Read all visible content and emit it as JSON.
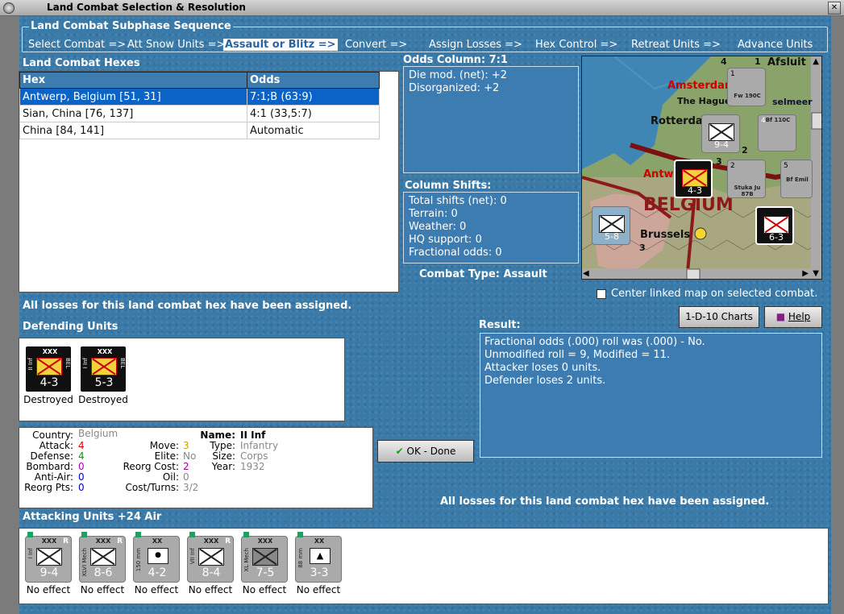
{
  "window": {
    "title": "Land Combat Selection & Resolution"
  },
  "phase": {
    "label": "Land Combat Subphase Sequence",
    "steps": [
      "Select Combat =>",
      "Att Snow Units =>",
      "Assault or Blitz =>",
      "Convert =>",
      "Assign Losses =>",
      "Hex Control =>",
      "Retreat Units =>",
      "Advance Units"
    ]
  },
  "hexes": {
    "label": "Land Combat Hexes",
    "columns": [
      "Hex",
      "Odds"
    ],
    "rows": [
      [
        "Antwerp, Belgium [51, 31]",
        "7:1;B (63:9)"
      ],
      [
        "Sian, China [76, 137]",
        "4:1 (33,5:7)"
      ],
      [
        "China [84, 141]",
        "Automatic"
      ]
    ]
  },
  "odds": {
    "label": "Odds Column: 7:1",
    "lines": [
      "Die mod. (net): +2",
      "Disorganized: +2"
    ]
  },
  "shifts": {
    "label": "Column Shifts:",
    "lines": [
      "Total shifts (net): 0",
      "Terrain: 0",
      "Weather: 0",
      "HQ support: 0",
      "Fractional odds: 0"
    ]
  },
  "combat_type": "Combat Type:  Assault",
  "map": {
    "labels": [
      "Afsluit",
      "Amsterdam",
      "The Hague",
      "selmeer",
      "Rotterdam",
      "Antwerp",
      "BELGIUM",
      "Brussels"
    ],
    "hexnums": [
      "4",
      "1",
      "2",
      "3",
      "3"
    ],
    "units": [
      {
        "name": "Fw 190C",
        "str": "1"
      },
      {
        "name": "Bf 110C",
        "str": "4"
      },
      {
        "name": "9-4",
        "str": "9-4"
      },
      {
        "name": "4-3",
        "str": "4-3"
      },
      {
        "name": "Stuka Ju 87B",
        "str": "2"
      },
      {
        "name": "Bf Emil",
        "str": "5"
      },
      {
        "name": "5-8",
        "str": "5-8"
      },
      {
        "name": "6-3",
        "str": "6-3"
      }
    ]
  },
  "center_link": "Center linked map on selected combat.",
  "losses_msg": "All losses for this land combat hex have been assigned.",
  "buttons": {
    "charts": "1-D-10 Charts",
    "help": "Help",
    "ok": "OK - Done"
  },
  "defending": {
    "label": "Defending Units",
    "units": [
      {
        "name": "II Inf",
        "nat": "BEL",
        "size": "XXX",
        "str": "4-3",
        "status": "Destroyed"
      },
      {
        "name": "I Inf",
        "nat": "BEL",
        "size": "XXX",
        "str": "5-3",
        "status": "Destroyed"
      }
    ]
  },
  "result": {
    "label": "Result:",
    "lines": [
      "Fractional odds (.000) roll was (.000)  - No.",
      "Unmodified roll = 9, Modified = 11.",
      "Attacker loses 0 units.",
      "Defender loses 2 units."
    ]
  },
  "info": {
    "country_k": "Country:",
    "country": "Belgium",
    "attack_k": "Attack:",
    "attack": "4",
    "defense_k": "Defense:",
    "defense": "4",
    "bombard_k": "Bombard:",
    "bombard": "0",
    "antiair_k": "Anti-Air:",
    "antiair": "0",
    "reorgpts_k": "Reorg Pts:",
    "reorgpts": "0",
    "move_k": "Move:",
    "move": "3",
    "elite_k": "Elite:",
    "elite": "No",
    "reorgcost_k": "Reorg Cost:",
    "reorgcost": "2",
    "oil_k": "Oil:",
    "oil": "0",
    "costturns_k": "Cost/Turns:",
    "costturns": "3/2",
    "name_k": "Name:",
    "name": "II Inf",
    "type_k": "Type:",
    "type": "Infantry",
    "size_k": "Size:",
    "size": "Corps",
    "year_k": "Year:",
    "year": "1932"
  },
  "attacking": {
    "label": "Attacking Units +24 Air",
    "units": [
      {
        "name": "I Inf",
        "size": "XXX",
        "str": "9-4",
        "r": "R",
        "status": "No effect"
      },
      {
        "name": "XLVI Mech",
        "size": "XXX",
        "str": "8-6",
        "r": "R",
        "status": "No effect"
      },
      {
        "name": "150 mm",
        "size": "XX",
        "str": "4-2",
        "r": "",
        "status": "No effect"
      },
      {
        "name": "VII Inf",
        "size": "XXX",
        "str": "8-4",
        "r": "R",
        "status": "No effect"
      },
      {
        "name": "XL Mech",
        "size": "XXX",
        "str": "7-5",
        "r": "",
        "status": "No effect"
      },
      {
        "name": "88 mm",
        "size": "XX",
        "str": "3-3",
        "r": "",
        "status": "No effect"
      }
    ]
  },
  "colors": {
    "accent": "#3d7cb0",
    "selected": "#0a64c8",
    "attack": "#e00000",
    "defense": "#00a000",
    "move": "#c8a000",
    "bombard": "#b000b0",
    "antiair": "#0000c0",
    "reorg": "#a000a0"
  }
}
